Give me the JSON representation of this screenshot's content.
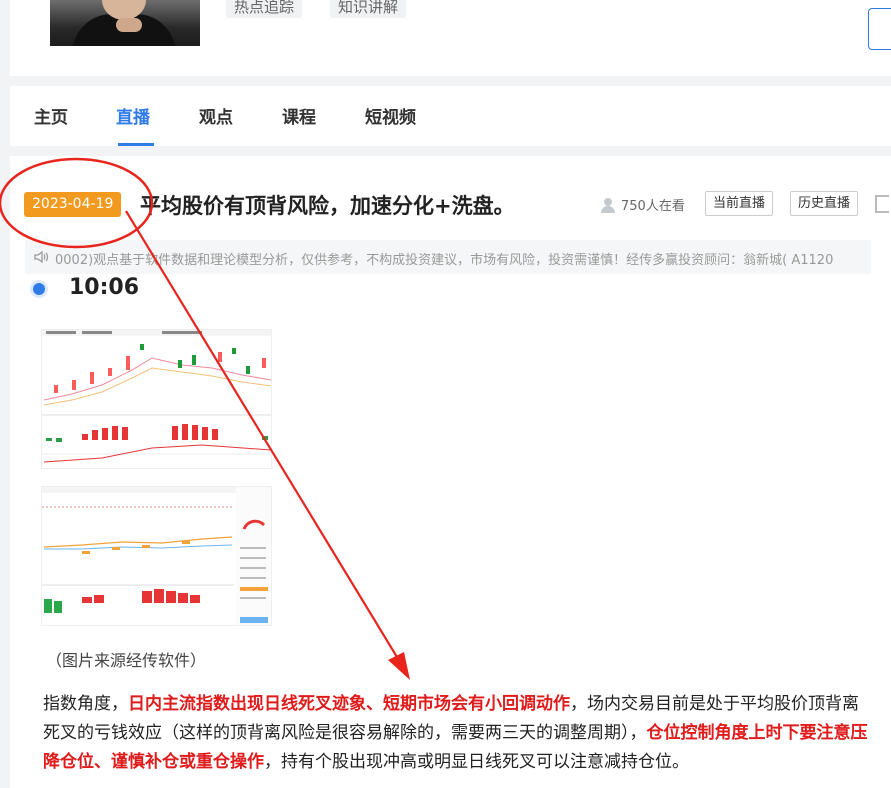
{
  "header": {
    "tags": [
      "热点追踪",
      "知识讲解"
    ]
  },
  "nav": {
    "tabs": [
      "主页",
      "直播",
      "观点",
      "课程",
      "短视频"
    ],
    "active_index": 1
  },
  "live": {
    "date": "2023-04-19",
    "title": "平均股价有顶背风险，加速分化+洗盘。",
    "viewers": "750人在看",
    "current_live_label": "当前直播",
    "history_live_label": "历史直播",
    "notice": "0002)观点基于软件数据和理论模型分析，仅供参考，不构成投资建议，市场有风险，投资需谨慎！经传多赢投资顾问：翁新城( A1120",
    "time": "10:06",
    "caption": "（图片来源经传软件）",
    "article": [
      {
        "text": "指数角度，",
        "highlight": false
      },
      {
        "text": "日内主流指数出现日线死叉迹象、短期市场会有小回调动作",
        "highlight": true
      },
      {
        "text": "，场内交易目前是处于平均股价顶背离死叉的亏钱效应（这样的顶背离风险是很容易解除的，需要两三天的调整周期），",
        "highlight": false
      },
      {
        "text": "仓位控制角度上时下要注意压降仓位、谨慎补仓或重仓操作",
        "highlight": true
      },
      {
        "text": "，持有个股出现冲高或明显日线死叉可以注意减持仓位。",
        "highlight": false
      }
    ]
  },
  "colors": {
    "accent": "#2f7be8",
    "badge": "#f29a1f",
    "highlight": "#e01b1b",
    "annotation": "#e8241c"
  }
}
